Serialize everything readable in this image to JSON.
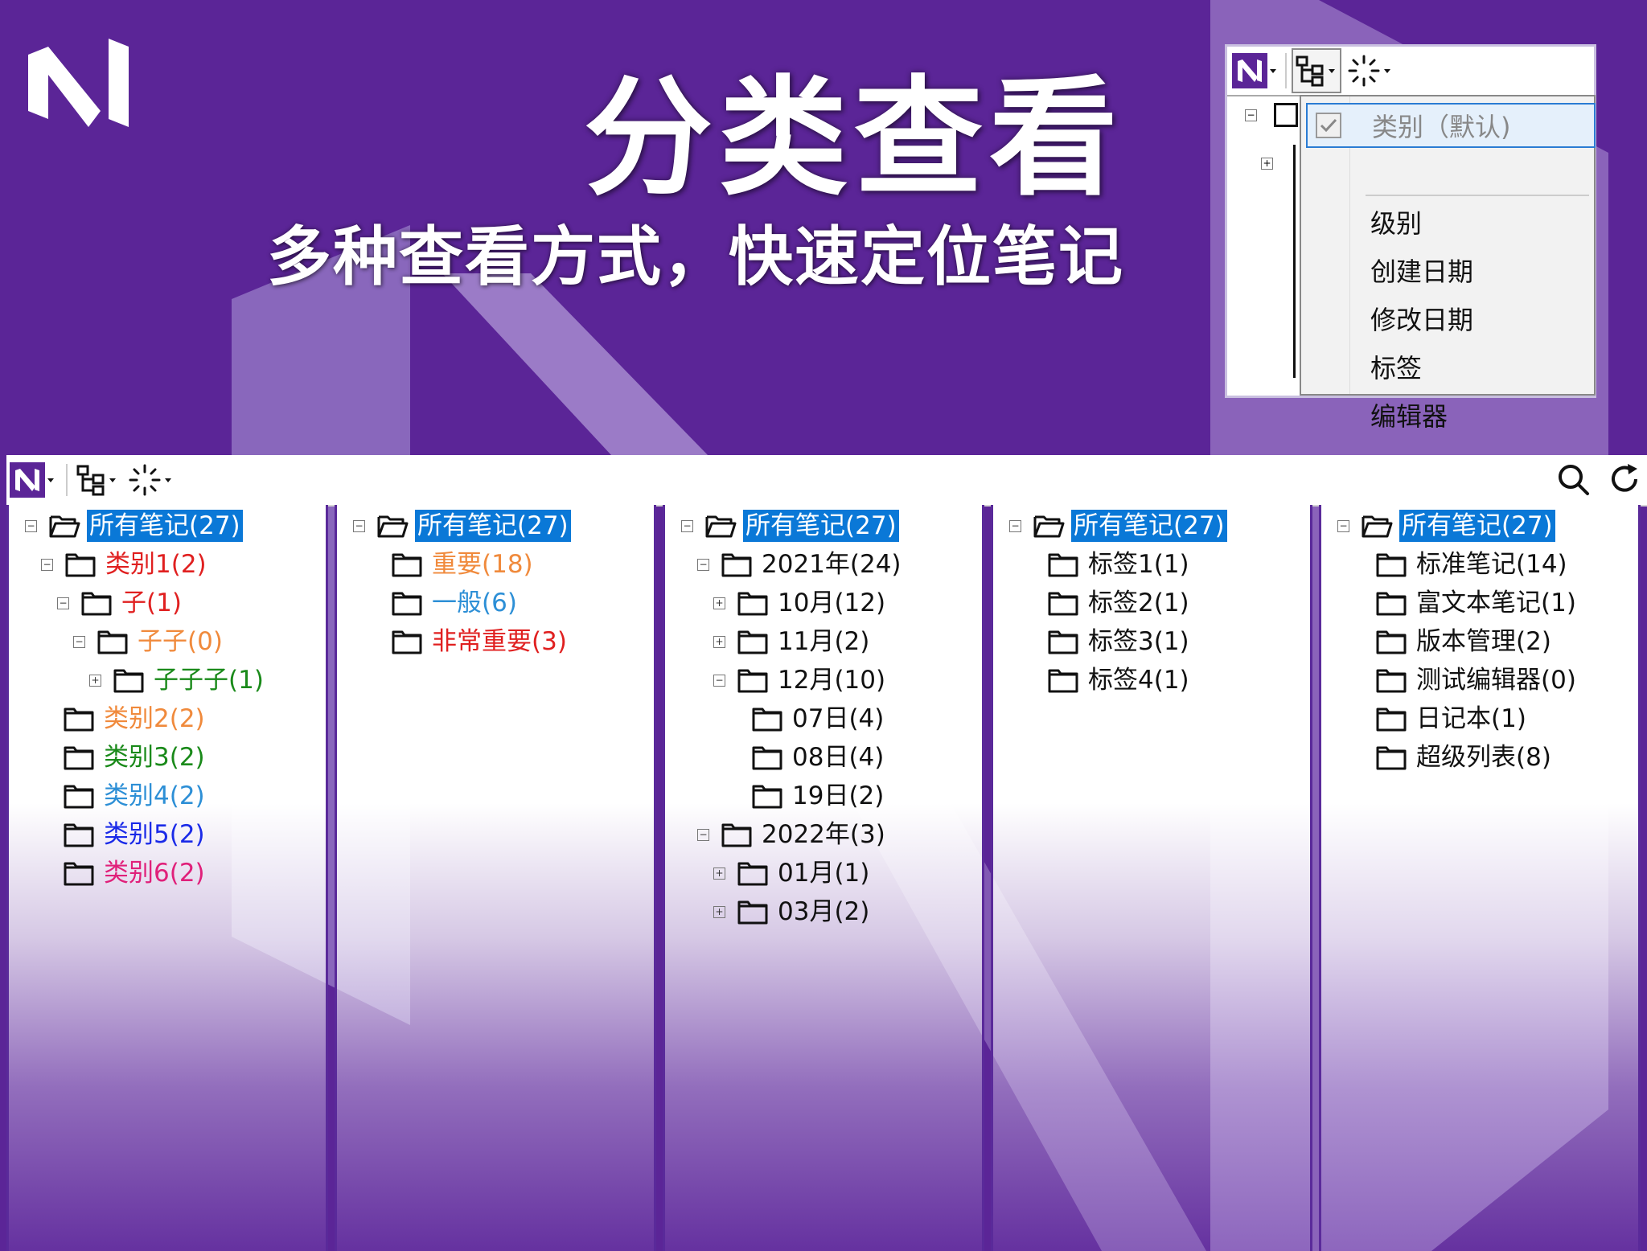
{
  "banner": {
    "title": "分类查看",
    "subtitle": "多种查看方式，快速定位笔记"
  },
  "colors": {
    "background": "#5b2597",
    "selection": "#0a78d7",
    "red": "#e02020",
    "orange": "#f08a3c",
    "green": "#1a8a1a",
    "lightblue": "#2d8fd6",
    "blue": "#1a2ae8",
    "magenta": "#e0207a"
  },
  "popup": {
    "menu_items": [
      {
        "label": "类别（默认)",
        "checked": true,
        "disabled": true
      },
      {
        "label": "级别"
      },
      {
        "label": "创建日期"
      },
      {
        "label": "修改日期"
      },
      {
        "label": "标签"
      },
      {
        "label": "编辑器"
      }
    ]
  },
  "panes": [
    {
      "view": "category",
      "nodes": [
        {
          "label": "所有笔记(27)",
          "depth": 0,
          "expander": "−",
          "selected": true,
          "open": true
        },
        {
          "label": "类别1(2)",
          "depth": 1,
          "expander": "−",
          "color": "red"
        },
        {
          "label": "子(1)",
          "depth": 2,
          "expander": "−",
          "color": "red"
        },
        {
          "label": "子子(0)",
          "depth": 3,
          "expander": "−",
          "color": "orange"
        },
        {
          "label": "子子子(1)",
          "depth": 4,
          "expander": "+",
          "color": "green"
        },
        {
          "label": "类别2(2)",
          "depth": 1,
          "color": "orange"
        },
        {
          "label": "类别3(2)",
          "depth": 1,
          "color": "green"
        },
        {
          "label": "类别4(2)",
          "depth": 1,
          "color": "lightblue"
        },
        {
          "label": "类别5(2)",
          "depth": 1,
          "color": "blue"
        },
        {
          "label": "类别6(2)",
          "depth": 1,
          "color": "magenta"
        }
      ]
    },
    {
      "view": "level",
      "nodes": [
        {
          "label": "所有笔记(27)",
          "depth": 0,
          "expander": "−",
          "selected": true,
          "open": true
        },
        {
          "label": "重要(18)",
          "depth": 1,
          "color": "orange"
        },
        {
          "label": "一般(6)",
          "depth": 1,
          "color": "lightblue"
        },
        {
          "label": "非常重要(3)",
          "depth": 1,
          "color": "red"
        }
      ]
    },
    {
      "view": "date",
      "nodes": [
        {
          "label": "所有笔记(27)",
          "depth": 0,
          "expander": "−",
          "selected": true,
          "open": true
        },
        {
          "label": "2021年(24)",
          "depth": 1,
          "expander": "−"
        },
        {
          "label": "10月(12)",
          "depth": 2,
          "expander": "+"
        },
        {
          "label": "11月(2)",
          "depth": 2,
          "expander": "+"
        },
        {
          "label": "12月(10)",
          "depth": 2,
          "expander": "−"
        },
        {
          "label": "07日(4)",
          "depth": 3
        },
        {
          "label": "08日(4)",
          "depth": 3
        },
        {
          "label": "19日(2)",
          "depth": 3
        },
        {
          "label": "2022年(3)",
          "depth": 1,
          "expander": "−"
        },
        {
          "label": "01月(1)",
          "depth": 2,
          "expander": "+"
        },
        {
          "label": "03月(2)",
          "depth": 2,
          "expander": "+"
        }
      ]
    },
    {
      "view": "tag",
      "nodes": [
        {
          "label": "所有笔记(27)",
          "depth": 0,
          "expander": "−",
          "selected": true,
          "open": true
        },
        {
          "label": "标签1(1)",
          "depth": 1
        },
        {
          "label": "标签2(1)",
          "depth": 1
        },
        {
          "label": "标签3(1)",
          "depth": 1
        },
        {
          "label": "标签4(1)",
          "depth": 1
        }
      ]
    },
    {
      "view": "editor",
      "nodes": [
        {
          "label": "所有笔记(27)",
          "depth": 0,
          "expander": "−",
          "selected": true,
          "open": true
        },
        {
          "label": "标准笔记(14)",
          "depth": 1
        },
        {
          "label": "富文本笔记(1)",
          "depth": 1
        },
        {
          "label": "版本管理(2)",
          "depth": 1
        },
        {
          "label": "测试编辑器(0)",
          "depth": 1
        },
        {
          "label": "日记本(1)",
          "depth": 1
        },
        {
          "label": "超级列表(8)",
          "depth": 1
        }
      ]
    }
  ]
}
